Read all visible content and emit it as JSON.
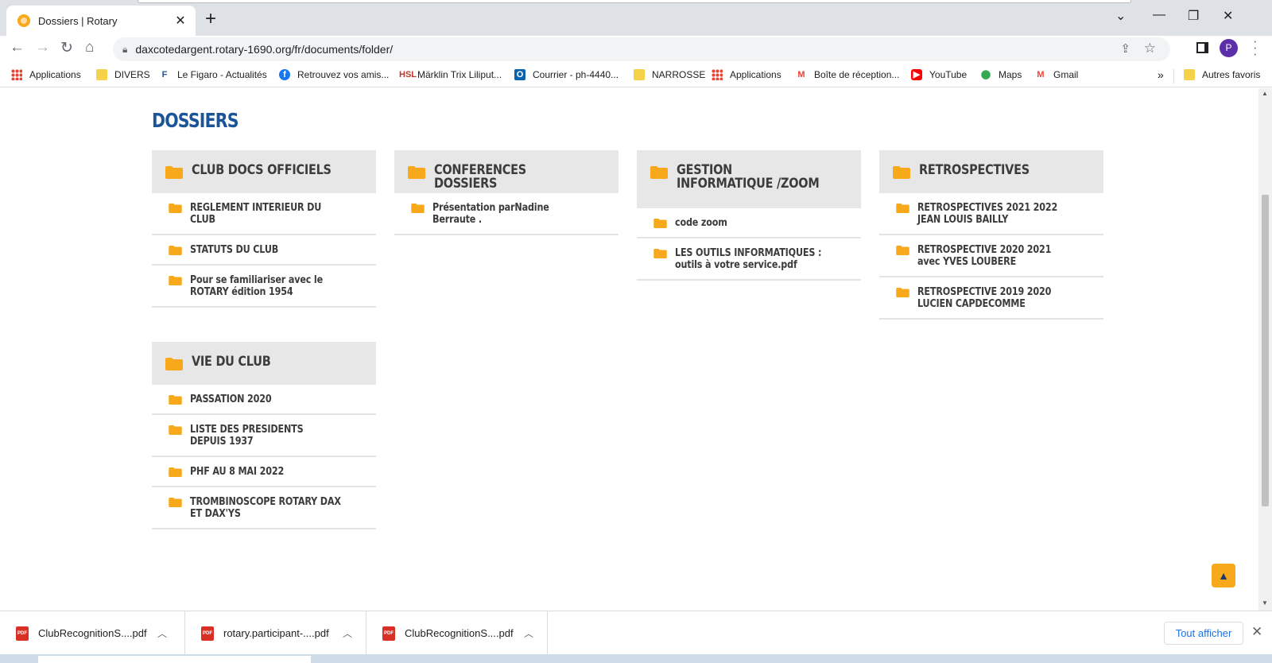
{
  "browser": {
    "tab_title": "Dossiers | Rotary",
    "url": "daxcotedargent.rotary-1690.org/fr/documents/folder/",
    "profile_initial": "P",
    "bookmarks": [
      {
        "label": "Applications",
        "icon": "apps-icon"
      },
      {
        "label": "DIVERS",
        "icon": "folder-icon"
      },
      {
        "label": "Le Figaro - Actualités",
        "icon": "figaro-icon"
      },
      {
        "label": "Retrouvez vos amis...",
        "icon": "facebook-icon"
      },
      {
        "label": "Märklin Trix Liliput...",
        "icon": "hsl-icon"
      },
      {
        "label": "Courrier - ph-4440...",
        "icon": "outlook-icon"
      },
      {
        "label": "NARROSSE",
        "icon": "folder-icon"
      },
      {
        "label": "Applications",
        "icon": "apps-icon"
      },
      {
        "label": "Boîte de réception...",
        "icon": "gmail-icon"
      },
      {
        "label": "YouTube",
        "icon": "youtube-icon"
      },
      {
        "label": "Maps",
        "icon": "maps-icon"
      },
      {
        "label": "Gmail",
        "icon": "gmail-icon"
      }
    ],
    "other_bookmarks": "Autres favoris"
  },
  "page": {
    "title": "DOSSIERS",
    "folder_color": "#f7a81b",
    "title_color": "#1b5597",
    "cards": [
      {
        "title": "CLUB DOCS OFFICIELS",
        "items": [
          "REGLEMENT INTERIEUR DU CLUB",
          "STATUTS DU CLUB",
          "Pour se familiariser avec le ROTARY édition 1954"
        ]
      },
      {
        "title": "CONFERENCES DOSSIERS",
        "items": [
          "Présentation parNadine Berraute ."
        ]
      },
      {
        "title": "GESTION INFORMATIQUE /ZOOM",
        "items": [
          "code zoom",
          "LES OUTILS INFORMATIQUES : outils à votre service.pdf"
        ]
      },
      {
        "title": "RETROSPECTIVES",
        "items": [
          "RETROSPECTIVES 2021 2022 JEAN LOUIS BAILLY",
          "RETROSPECTIVE 2020 2021 avec YVES LOUBERE",
          "RETROSPECTIVE 2019 2020 LUCIEN CAPDECOMME"
        ]
      },
      {
        "title": "VIE DU CLUB",
        "items": [
          "PASSATION 2020",
          "LISTE DES PRESIDENTS DEPUIS 1937",
          "PHF AU 8 MAI 2022",
          "TROMBINOSCOPE ROTARY DAX ET DAX'YS"
        ]
      }
    ]
  },
  "downloads": {
    "files": [
      "ClubRecognitionS....pdf",
      "rotary.participant-....pdf",
      "ClubRecognitionS....pdf"
    ],
    "file_icon": "PDF",
    "show_all": "Tout afficher"
  }
}
